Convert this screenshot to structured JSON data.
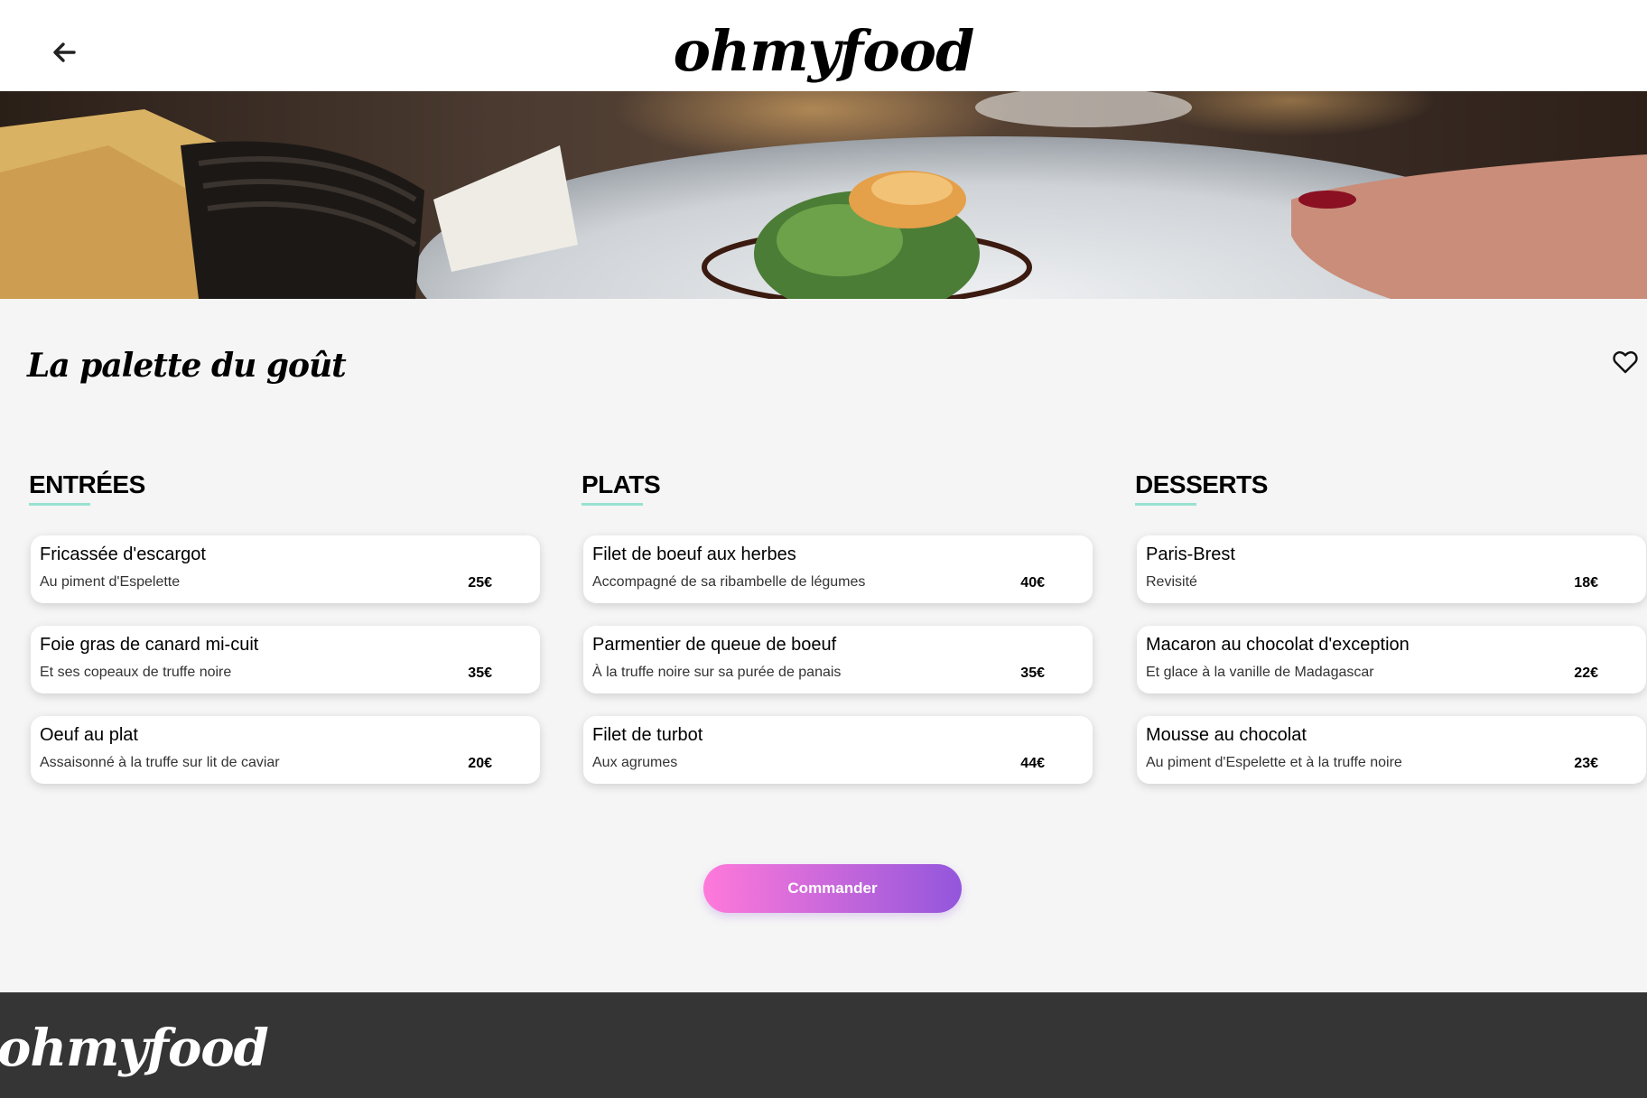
{
  "header": {
    "logo": "ohmyfood",
    "back_icon": "arrow-left-icon"
  },
  "hero": {
    "image": "plated-fish-dish-photo"
  },
  "restaurant": {
    "name": "La palette du goût",
    "like_icon": "heart-outline-icon"
  },
  "menu": {
    "sections": [
      {
        "title": "ENTRÉES",
        "dishes": [
          {
            "name": "Fricassée d'escargot",
            "desc": "Au piment d'Espelette",
            "price": "25€"
          },
          {
            "name": "Foie gras de canard mi-cuit",
            "desc": "Et ses copeaux de truffe noire",
            "price": "35€"
          },
          {
            "name": "Oeuf au plat",
            "desc": "Assaisonné à la truffe sur lit de caviar",
            "price": "20€"
          }
        ]
      },
      {
        "title": "PLATS",
        "dishes": [
          {
            "name": "Filet de boeuf aux herbes",
            "desc": "Accompagné de sa ribambelle de légumes",
            "price": "40€"
          },
          {
            "name": "Parmentier de queue de boeuf",
            "desc": "À la truffe noire sur sa purée de panais",
            "price": "35€"
          },
          {
            "name": "Filet de turbot",
            "desc": "Aux agrumes",
            "price": "44€"
          }
        ]
      },
      {
        "title": "DESSERTS",
        "dishes": [
          {
            "name": "Paris-Brest",
            "desc": "Revisité",
            "price": "18€"
          },
          {
            "name": "Macaron au chocolat d'exception",
            "desc": "Et glace à la vanille de Madagascar",
            "price": "22€"
          },
          {
            "name": "Mousse au chocolat",
            "desc": "Au piment d'Espelette et à la truffe noire",
            "price": "23€"
          }
        ]
      }
    ]
  },
  "order_button": {
    "label": "Commander"
  },
  "footer": {
    "logo": "ohmyfood"
  },
  "colors": {
    "accent_underline": "#99e2d0",
    "button_gradient_start": "#ff79da",
    "button_gradient_end": "#9356dc",
    "footer_bg": "#353535",
    "page_bg": "#f5f5f5"
  }
}
